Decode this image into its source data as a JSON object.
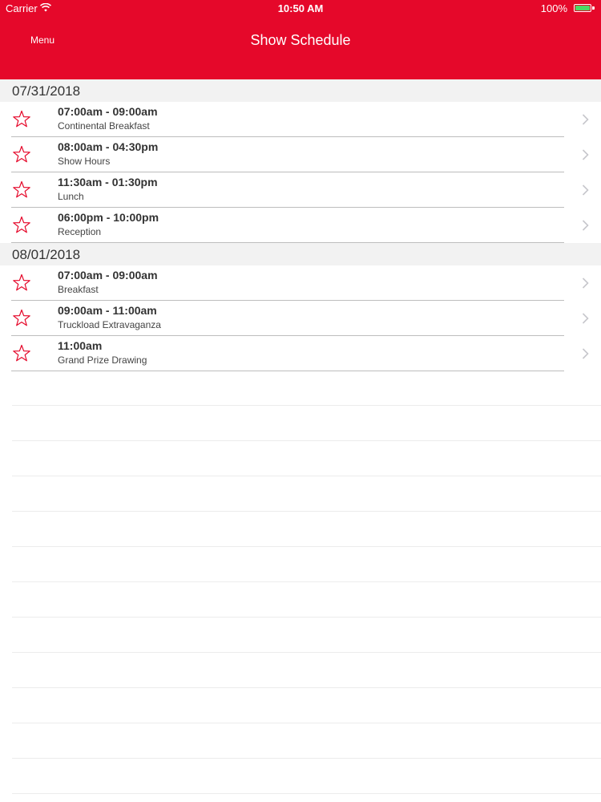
{
  "status_bar": {
    "carrier": "Carrier",
    "time": "10:50 AM",
    "battery": "100%"
  },
  "nav": {
    "menu_label": "Menu",
    "title": "Show Schedule",
    "background": "#e5082a"
  },
  "sections": [
    {
      "date": "07/31/2018",
      "items": [
        {
          "time": "07:00am - 09:00am",
          "title": "Continental Breakfast"
        },
        {
          "time": "08:00am - 04:30pm",
          "title": "Show Hours"
        },
        {
          "time": "11:30am - 01:30pm",
          "title": "Lunch"
        },
        {
          "time": "06:00pm - 10:00pm",
          "title": "Reception"
        }
      ]
    },
    {
      "date": "08/01/2018",
      "items": [
        {
          "time": "07:00am - 09:00am",
          "title": "Breakfast"
        },
        {
          "time": "09:00am - 11:00am",
          "title": "Truckload Extravaganza"
        },
        {
          "time": "11:00am",
          "title": "Grand Prize Drawing"
        }
      ]
    }
  ],
  "icons": {
    "favorite": "star-outline-icon",
    "disclosure": "chevron-right-icon"
  },
  "colors": {
    "accent": "#e5082a",
    "star": "#e5082a",
    "separator": "#bdbdbd"
  }
}
